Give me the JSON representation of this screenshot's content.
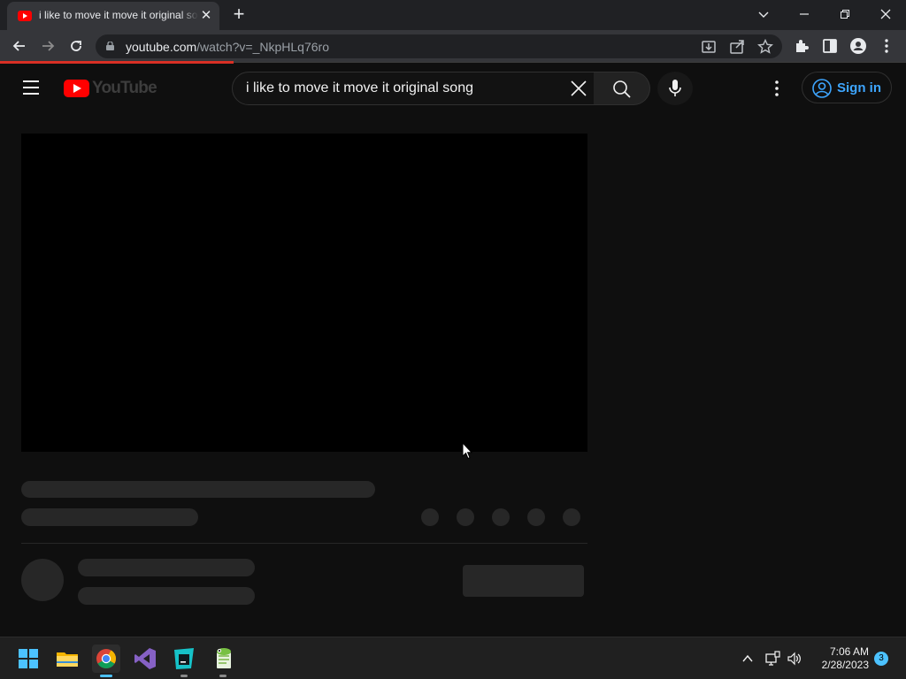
{
  "browser": {
    "tab_title": "i like to move it move it original song - YouTube",
    "new_tab_symbol": "+",
    "url_host": "youtube.com",
    "url_path": "/watch?v=_NkpHLq76ro"
  },
  "youtube": {
    "logo_text": "YouTube",
    "search_query": "i like to move it move it original song",
    "sign_in_label": "Sign in",
    "brand_red": "#ff0000",
    "accent_blue": "#3ea6ff"
  },
  "taskbar": {
    "time": "7:06 AM",
    "date": "2/28/2023",
    "notification_count": "3",
    "apps": [
      "windows-start-icon",
      "file-explorer-icon",
      "chrome-icon",
      "visual-studio-icon",
      "intellij-icon",
      "notepad-plus-plus-icon"
    ]
  }
}
